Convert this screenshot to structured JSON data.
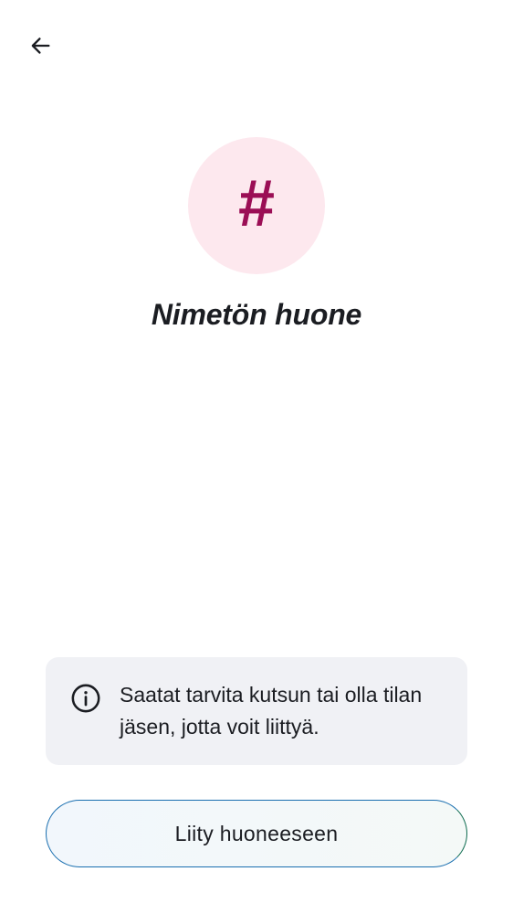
{
  "header": {
    "back_icon": "arrow-left-icon"
  },
  "room": {
    "avatar_glyph": "#",
    "avatar_color": "#9b0e55",
    "avatar_background": "#fde8ee",
    "title": "Nimetön huone"
  },
  "notice": {
    "icon": "info-icon",
    "text": "Saatat tarvita kutsun tai olla tilan jäsen, jotta voit liittyä."
  },
  "actions": {
    "join_label": "Liity huoneeseen"
  }
}
